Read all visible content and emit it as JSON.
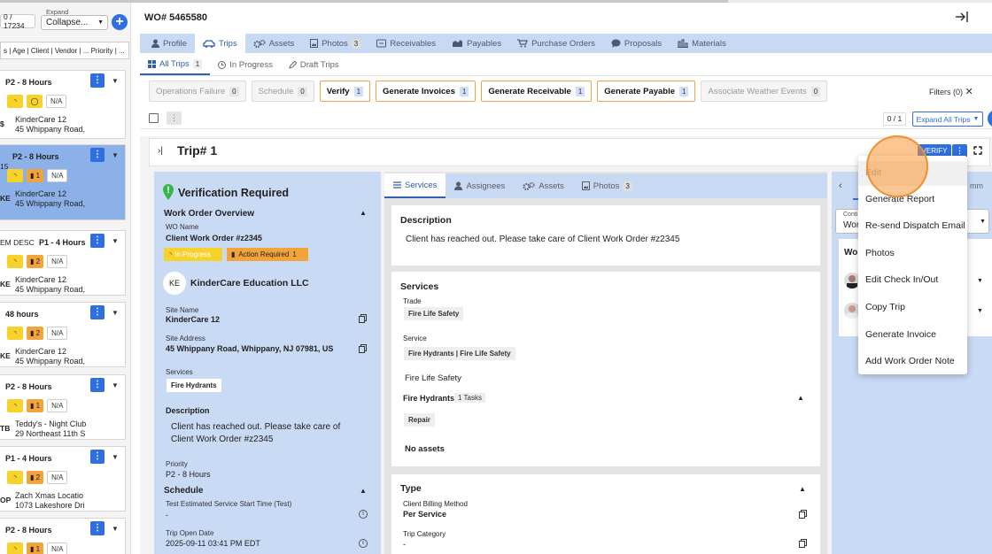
{
  "sidebar": {
    "count": "0 / 17234",
    "expand_label": "Expand",
    "expand_value": "Collapse...",
    "columns": "s | Age | Client | Vendor | ... Priority | ...",
    "cards": [
      {
        "priority": "P2 - 8 Hours",
        "ini": "$",
        "name": "KinderCare 12",
        "addr": "45 Whippany Road,",
        "tags": [
          "◝",
          "◯",
          "N/A"
        ],
        "sel": false
      },
      {
        "priority": "P2 - 8 Hours",
        "ini": "KE",
        "name": "KinderCare 12",
        "addr": "45 Whippany Road,",
        "tags": [
          "◝",
          "▮ 1",
          "N/A"
        ],
        "sel": true,
        "pre": "15"
      },
      {
        "priority": "P1 - 4 Hours",
        "ini": "KE",
        "name": "KinderCare 12",
        "addr": "45 Whippany Road,",
        "tags": [
          "◝",
          "▮ 2",
          "N/A"
        ],
        "sel": false,
        "pre": "EM DESC"
      },
      {
        "priority": "48 hours",
        "ini": "KE",
        "name": "KinderCare 12",
        "addr": "45 Whippany Road,",
        "tags": [
          "◝",
          "▮ 2",
          "N/A"
        ],
        "sel": false
      },
      {
        "priority": "P2 - 8 Hours",
        "ini": "TB",
        "name": "Teddy's - Night Club",
        "addr": "29 Northeast 11th S",
        "tags": [
          "◝",
          "▮ 1",
          "N/A"
        ],
        "sel": false
      },
      {
        "priority": "P1 - 4 Hours",
        "ini": "OP",
        "name": "Zach Xmas Locatio",
        "addr": "1073 Lakeshore Dri",
        "tags": [
          "◝",
          "▮ 2",
          "N/A"
        ],
        "sel": false
      },
      {
        "priority": "P2 - 8 Hours",
        "ini": "",
        "name": "",
        "addr": "",
        "tags": [
          "◝",
          "▮ 1",
          "N/A"
        ],
        "sel": false
      }
    ]
  },
  "header": {
    "wo": "WO# 5465580"
  },
  "tabs": [
    {
      "label": "Profile",
      "icon": "person-icon"
    },
    {
      "label": "Trips",
      "icon": "car-icon",
      "active": true
    },
    {
      "label": "Assets",
      "icon": "gears-icon"
    },
    {
      "label": "Photos",
      "icon": "photo-icon",
      "badge": "3"
    },
    {
      "label": "Receivables",
      "icon": "receivables-icon"
    },
    {
      "label": "Payables",
      "icon": "payables-icon"
    },
    {
      "label": "Purchase Orders",
      "icon": "cart-icon"
    },
    {
      "label": "Proposals",
      "icon": "chat-icon"
    },
    {
      "label": "Materials",
      "icon": "materials-icon"
    }
  ],
  "subtabs": [
    {
      "label": "All Trips",
      "badge": "1",
      "active": true
    },
    {
      "label": "In Progress"
    },
    {
      "label": "Draft Trips"
    }
  ],
  "chips": [
    {
      "label": "Operations Failure",
      "n": "0",
      "on": false
    },
    {
      "label": "Schedule",
      "n": "0",
      "on": false
    },
    {
      "label": "Verify",
      "n": "1",
      "on": true
    },
    {
      "label": "Generate Invoices",
      "n": "1",
      "on": true
    },
    {
      "label": "Generate Receivable",
      "n": "1",
      "on": true
    },
    {
      "label": "Generate Payable",
      "n": "1",
      "on": true
    },
    {
      "label": "Associate Weather Events",
      "n": "0",
      "on": false
    }
  ],
  "filters": "Filters (0)",
  "pager": "0 / 1",
  "expand_all": "Expand All Trips",
  "trip": {
    "title": "Trip# 1",
    "verify": "VERIFY"
  },
  "info": {
    "title": "Verification Required",
    "section": "Work Order Overview",
    "wo_name_label": "WO Name",
    "wo_name": "Client Work Order #z2345",
    "status1": "In Progress",
    "status2": "Action Required",
    "status2_n": "1",
    "company_ini": "KE",
    "company": "KinderCare Education LLC",
    "site_name_label": "Site Name",
    "site_name": "KinderCare 12",
    "site_addr_label": "Site Address",
    "site_addr": "45 Whippany Road, Whippany, NJ 07981, US",
    "services_label": "Services",
    "service": "Fire Hydrants",
    "desc_label": "Description",
    "desc1": "Client has reached out. Please take care of",
    "desc2": "Client Work Order #z2345",
    "priority_label": "Priority",
    "priority": "P2 - 8 Hours",
    "schedule": "Schedule",
    "test_label": "Test Estimated Service Start Time (Test)",
    "test_val": "-",
    "open_label": "Trip Open Date",
    "open_val": "2025-09-11 03:41 PM EDT"
  },
  "mid": {
    "tabs": [
      {
        "label": "Services",
        "icon": "list-icon",
        "active": true
      },
      {
        "label": "Assignees",
        "icon": "person-icon"
      },
      {
        "label": "Assets",
        "icon": "gears-icon"
      },
      {
        "label": "Photos",
        "icon": "photo-icon",
        "badge": "3"
      }
    ],
    "desc_h": "Description",
    "desc": "Client has reached out. Please take care of Client Work Order #z2345",
    "svc_h": "Services",
    "trade_label": "Trade",
    "trade": "Fire Life Safety",
    "service_label": "Service",
    "service": "Fire Hydrants | Fire Life Safety",
    "group": "Fire Life Safety",
    "sub": "Fire Hydrants",
    "tasks": "1 Tasks",
    "task": "Repair",
    "no_assets": "No assets",
    "type_h": "Type",
    "billing_label": "Client Billing Method",
    "billing": "Per Service",
    "cat_label": "Trip Category",
    "cat": "-"
  },
  "right": {
    "select_label": "Conti",
    "select_val": "Wor",
    "wo": "Wo",
    "frag": "mm"
  },
  "menu": [
    "Edit",
    "Generate Report",
    "Re-send Dispatch Email",
    "Photos",
    "Edit Check In/Out",
    "Copy Trip",
    "Generate Invoice",
    "Add Work Order Note"
  ],
  "colors": {
    "primary": "#2f6fe0",
    "tabbar": "#c8daf3",
    "panel": "#c9daf5",
    "yellow": "#f6d22b",
    "orange": "#f2a33a",
    "cursor": "#f09030"
  }
}
